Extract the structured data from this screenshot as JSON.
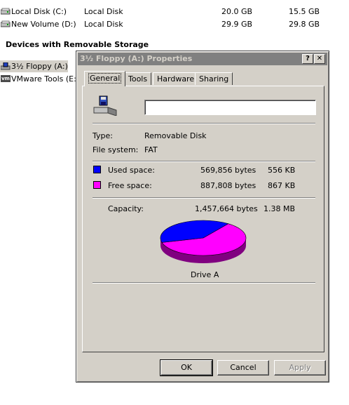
{
  "drives": [
    {
      "name": "Local Disk (C:)",
      "type": "Local Disk",
      "total": "20.0 GB",
      "free": "15.5 GB"
    },
    {
      "name": "New Volume (D:)",
      "type": "Local Disk",
      "total": "29.9 GB",
      "free": "29.8 GB"
    }
  ],
  "removable": {
    "header": "Devices with Removable Storage",
    "items": [
      {
        "name": "3½ Floppy (A:)",
        "selected": true,
        "icon": "floppy-drive-icon"
      },
      {
        "name": "VMware Tools (E:)",
        "selected": false,
        "icon": "vmware-cd-icon",
        "badge": "vm"
      }
    ]
  },
  "dialog": {
    "title": "3½ Floppy (A:) Properties",
    "help_label": "?",
    "close_label": "✕",
    "tabs": [
      {
        "label": "General",
        "active": true
      },
      {
        "label": "Tools",
        "active": false
      },
      {
        "label": "Hardware",
        "active": false
      },
      {
        "label": "Sharing",
        "active": false
      }
    ],
    "label_value": "",
    "type_label": "Type:",
    "type_value": "Removable Disk",
    "fs_label": "File system:",
    "fs_value": "FAT",
    "used": {
      "label": "Used space:",
      "bytes": "569,856 bytes",
      "size": "556 KB",
      "color": "#0000ff"
    },
    "free": {
      "label": "Free space:",
      "bytes": "887,808 bytes",
      "size": "867 KB",
      "color": "#ff00ff"
    },
    "capacity": {
      "label": "Capacity:",
      "bytes": "1,457,664 bytes",
      "size": "1.38 MB"
    },
    "drive_caption": "Drive A",
    "used_fraction": 0.391,
    "buttons": {
      "ok": "OK",
      "cancel": "Cancel",
      "apply": "Apply"
    }
  }
}
